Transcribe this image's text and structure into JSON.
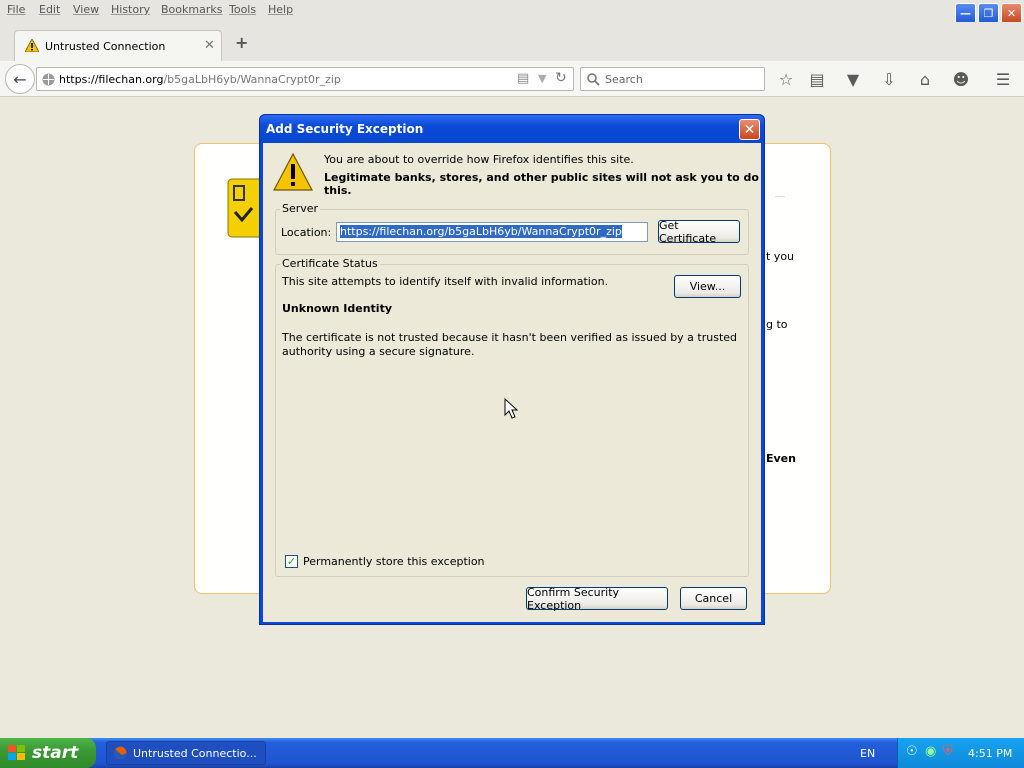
{
  "menubar": {
    "items": [
      "File",
      "Edit",
      "View",
      "History",
      "Bookmarks",
      "Tools",
      "Help"
    ]
  },
  "tab": {
    "title": "Untrusted Connection"
  },
  "navbar": {
    "url_host": "https://filechan.org",
    "url_path": "/b5gaLbH6yb/WannaCrypt0r_zip",
    "search_placeholder": "Search"
  },
  "page": {
    "fragments": [
      "t you",
      "g to",
      "Even"
    ]
  },
  "dialog": {
    "title": "Add Security Exception",
    "warning_line1": "You are about to override how Firefox identifies this site.",
    "warning_line2": "Legitimate banks, stores, and other public sites will not ask you to do this.",
    "server_legend": "Server",
    "location_label": "Location:",
    "location_value": "https://filechan.org/b5gaLbH6yb/WannaCrypt0r_zip",
    "get_certificate": "Get Certificate",
    "status_legend": "Certificate Status",
    "status_text": "This site attempts to identify itself with invalid information.",
    "view_button": "View...",
    "identity_heading": "Unknown Identity",
    "identity_text": "The certificate is not trusted because it hasn't been verified as issued by a trusted authority using a secure signature.",
    "permanent_label": "Permanently store this exception",
    "confirm_button": "Confirm Security Exception",
    "cancel_button": "Cancel"
  },
  "taskbar": {
    "start_label": "start",
    "task_label": "Untrusted Connectio...",
    "language": "EN",
    "clock": "4:51 PM"
  },
  "colors": {
    "xp_blue": "#0a46d8",
    "start_green": "#3c9a35",
    "warning_yellow": "#f5c400"
  }
}
